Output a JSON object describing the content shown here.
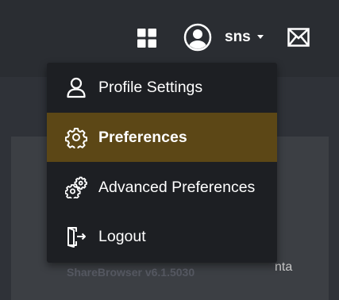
{
  "header": {
    "user_name": "sns",
    "icons": [
      "apps-grid-icon",
      "user-avatar-icon",
      "caret-down-icon",
      "mail-icon"
    ]
  },
  "background": {
    "text_fragment": "nta"
  },
  "menu": {
    "items": [
      {
        "label": "Profile Settings",
        "icon": "user-profile-icon",
        "active": false
      },
      {
        "label": "Preferences",
        "icon": "gear-icon",
        "active": true
      },
      {
        "label": "Advanced Preferences",
        "icon": "gears-icon",
        "active": false
      },
      {
        "label": "Logout",
        "icon": "logout-door-icon",
        "active": false
      }
    ],
    "version": "ShareBrowser v6.1.5030"
  },
  "colors": {
    "active_highlight": "#5c4716",
    "menu_background": "#1d1f23",
    "page_background": "#2b2e33"
  }
}
